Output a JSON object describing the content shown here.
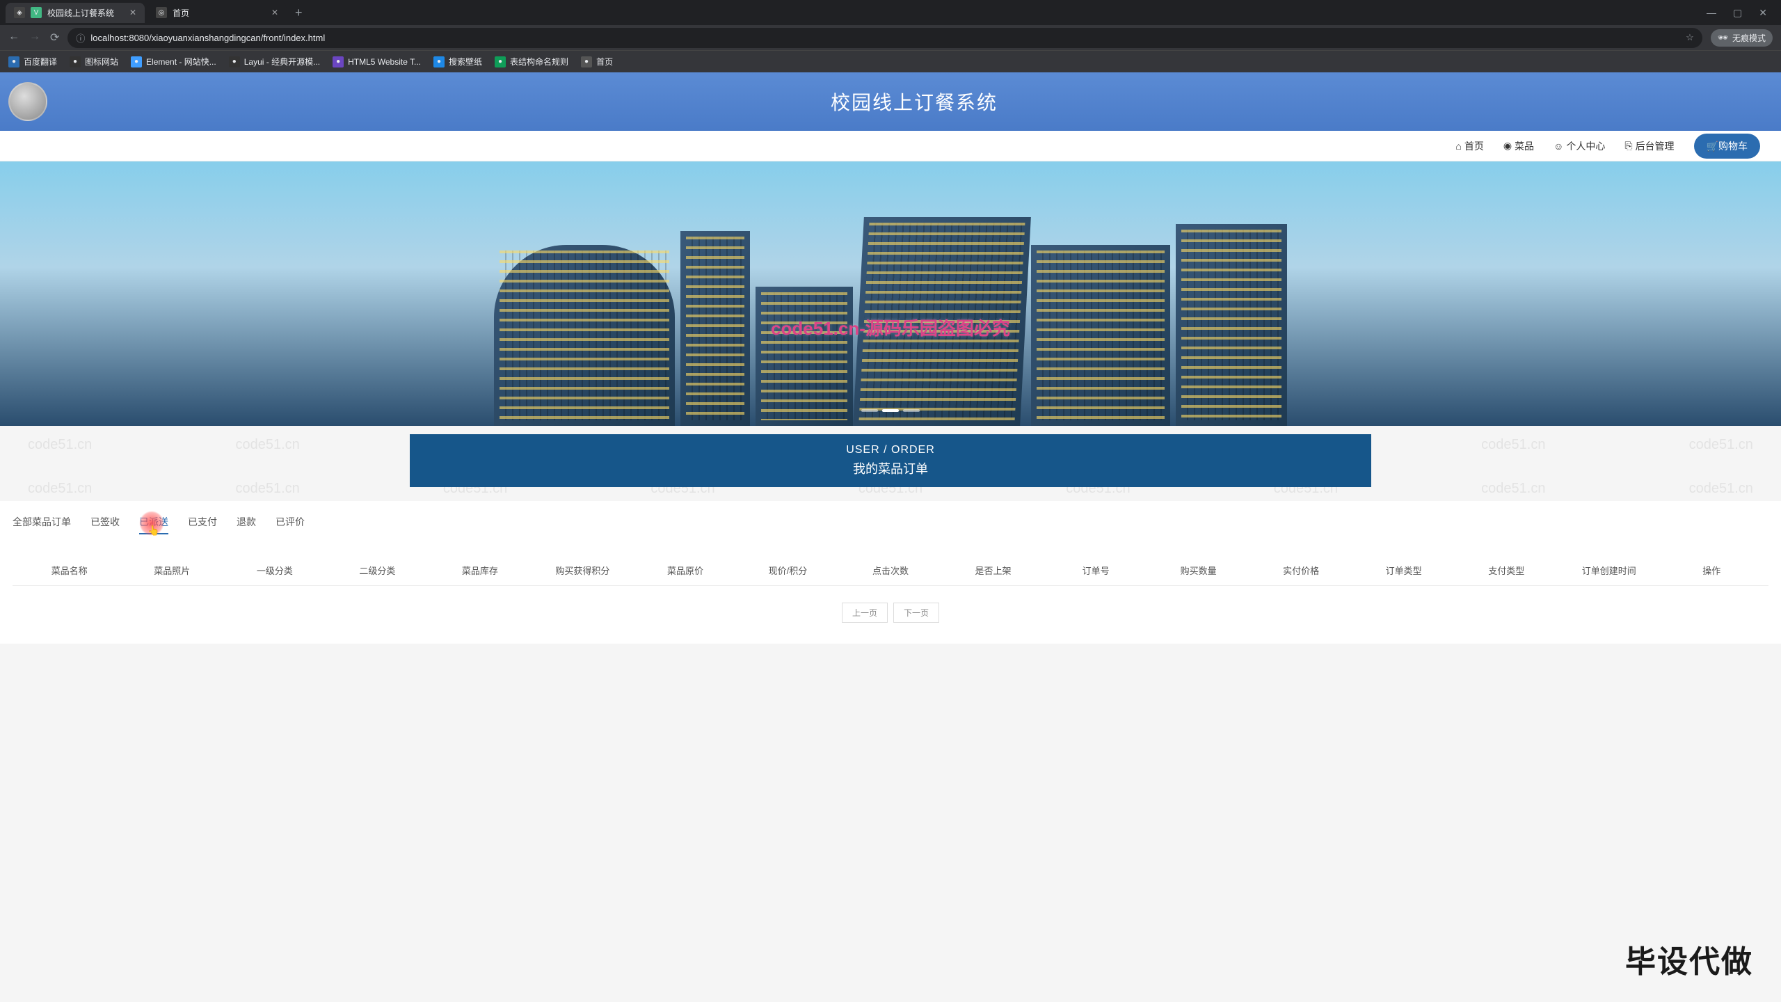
{
  "browser": {
    "tabs": [
      {
        "title": "校园线上订餐系统",
        "icon_color": "#41b883",
        "active": true
      },
      {
        "title": "首页",
        "icon_color": "#444",
        "active": false
      }
    ],
    "url": "localhost:8080/xiaoyuanxianshangdingcan/front/index.html",
    "incognito_label": "无痕模式",
    "bookmarks": [
      {
        "label": "百度翻译",
        "icon_bg": "#2b6cb0"
      },
      {
        "label": "图标网站",
        "icon_bg": "#333"
      },
      {
        "label": "Element - 网站快...",
        "icon_bg": "#409eff"
      },
      {
        "label": "Layui - 经典开源模...",
        "icon_bg": "#333"
      },
      {
        "label": "HTML5 Website T...",
        "icon_bg": "#6b46c1"
      },
      {
        "label": "搜索壁纸",
        "icon_bg": "#1e88e5"
      },
      {
        "label": "表结构命名规则",
        "icon_bg": "#0f9d58"
      },
      {
        "label": "首页",
        "icon_bg": "#555"
      }
    ]
  },
  "header": {
    "title": "校园线上订餐系统"
  },
  "nav": {
    "links": [
      {
        "icon": "⌂",
        "label": "首页"
      },
      {
        "icon": "◉",
        "label": "菜品"
      },
      {
        "icon": "☺",
        "label": "个人中心"
      },
      {
        "icon": "⎘",
        "label": "后台管理"
      }
    ],
    "cart_label": "购物车"
  },
  "hero": {
    "watermark_center": "code51.cn-源码乐园盗图必究"
  },
  "section": {
    "title_en": "USER / ORDER",
    "title_cn": "我的菜品订单"
  },
  "filters": {
    "tabs": [
      "全部菜品订单",
      "已签收",
      "已派送",
      "已支付",
      "退款",
      "已评价"
    ],
    "active_index": 2
  },
  "table": {
    "headers": [
      "菜品名称",
      "菜品照片",
      "一级分类",
      "二级分类",
      "菜品库存",
      "购买获得积分",
      "菜品原价",
      "现价/积分",
      "点击次数",
      "是否上架",
      "订单号",
      "购买数量",
      "实付价格",
      "订单类型",
      "支付类型",
      "订单创建时间",
      "操作"
    ]
  },
  "pagination": {
    "prev": "上一页",
    "next": "下一页"
  },
  "watermark": {
    "repeat_text": "code51.cn",
    "corner_text": "毕设代做"
  }
}
